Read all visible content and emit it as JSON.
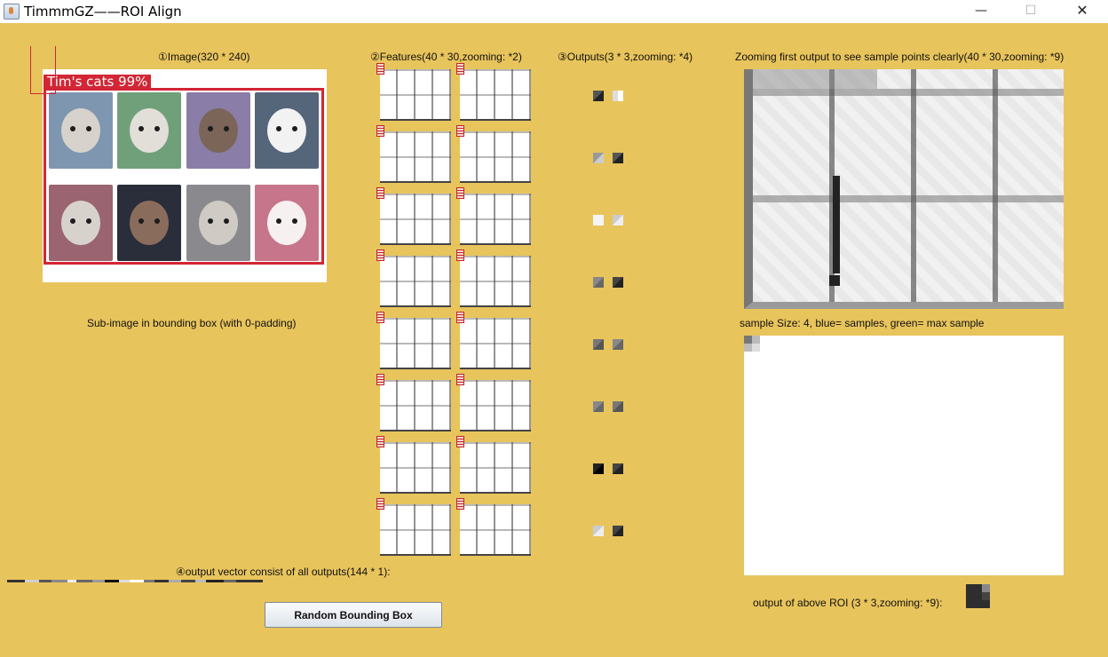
{
  "window": {
    "title": "TimmmGZ——ROI Align",
    "minimize": "—",
    "maximize": "☐",
    "close": "✕"
  },
  "labels": {
    "image": "①Image(320 * 240)",
    "features": "②Features(40 * 30,zooming: *2)",
    "outputs": "③Outputs(3 * 3,zooming: *4)",
    "zooming_first": "Zooming first output to see sample points clearly(40 * 30,zooming: *9)",
    "sub_image": "Sub-image in bounding box (with 0-padding)",
    "sample_size": "sample Size: 4, blue= samples, green= max sample",
    "output_vector": "④output vector consist of all outputs(144 * 1):",
    "roi_output": "output of above ROI (3 * 3,zooming: *9):"
  },
  "detection": {
    "label": "Tim's cats 99%"
  },
  "button": {
    "random_bbox": "Random Bounding Box"
  },
  "colors": {
    "background": "#e8c45c",
    "bbox": "#d22635"
  }
}
